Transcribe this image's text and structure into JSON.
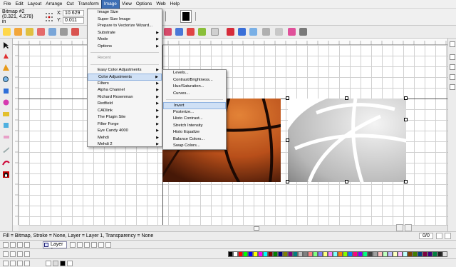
{
  "menubar": [
    "File",
    "Edit",
    "Layout",
    "Arrange",
    "Cut",
    "Transform",
    "Image",
    "View",
    "Options",
    "Web",
    "Help"
  ],
  "active_menu": "Image",
  "props": {
    "object_name": "Bitmap #2",
    "coords": "(0.321, 4.278)",
    "unit": "in",
    "x_label": "X:",
    "x_value": "10.629",
    "y_label": "Y:",
    "y_value": "0.011"
  },
  "image_menu": [
    {
      "label": "Image Size"
    },
    {
      "label": "Super Size Image"
    },
    {
      "label": "Prepare to Vectorize Wizard..."
    },
    {
      "label": "Substrate",
      "submenu": true
    },
    {
      "label": "Mode",
      "submenu": true
    },
    {
      "label": "Options",
      "submenu": true
    },
    {
      "sep": true
    },
    {
      "label": "Recent",
      "disabled": true
    },
    {
      "sep": true
    },
    {
      "label": "Easy Color Adjustments",
      "submenu": true
    },
    {
      "label": "Color Adjustments",
      "submenu": true,
      "highlighted": true
    },
    {
      "label": "Filters",
      "submenu": true
    },
    {
      "label": "Alpha Channel",
      "submenu": true
    },
    {
      "label": "Richard Rosenman",
      "submenu": true
    },
    {
      "label": "Redfield",
      "submenu": true
    },
    {
      "label": "CADlink",
      "submenu": true
    },
    {
      "label": "The Plugin Site",
      "submenu": true
    },
    {
      "label": "Filter Forge",
      "submenu": true
    },
    {
      "label": "Eye Candy 4000",
      "submenu": true
    },
    {
      "label": "Mehdi",
      "submenu": true
    },
    {
      "label": "Mehdi 2",
      "submenu": true
    }
  ],
  "color_submenu": [
    {
      "label": "Levels..."
    },
    {
      "label": "Contrast/Brightness..."
    },
    {
      "label": "Hue/Saturation..."
    },
    {
      "label": "Curves..."
    },
    {
      "sep": true
    },
    {
      "label": "Invert",
      "highlighted": true
    },
    {
      "label": "Posterize..."
    },
    {
      "label": "Histo Contrast..."
    },
    {
      "label": "Stretch Intensity"
    },
    {
      "label": "Histo Equalize"
    },
    {
      "label": "Balance Colors..."
    },
    {
      "label": "Swap Colors..."
    }
  ],
  "status_text": "Fill = Bitmap, Stroke = None, Layer = Layer 1, Transparency = None",
  "page_indicator": "0/0",
  "layer_name": "Layer 1",
  "colors": {
    "menu_highlight": "#3d6fb5",
    "submenu_highlight": "#cfe0f5",
    "basketball_orange": "#c35a1e",
    "grid": "#d0d0d0"
  },
  "palette": [
    "#000000",
    "#ffffff",
    "#ff0000",
    "#00ff00",
    "#0000ff",
    "#ffff00",
    "#ff00ff",
    "#00ffff",
    "#800000",
    "#008000",
    "#000080",
    "#808000",
    "#800080",
    "#008080",
    "#c0c0c0",
    "#808080",
    "#ff8080",
    "#80ff80",
    "#8080ff",
    "#ffff80",
    "#ff80ff",
    "#80ffff",
    "#ff8000",
    "#80ff00",
    "#0080ff",
    "#ff0080",
    "#8000ff",
    "#00ff80",
    "#404040",
    "#a0a0a0",
    "#ffc0c0",
    "#c0ffc0",
    "#c0c0ff",
    "#ffffc0",
    "#ffc0ff",
    "#c0ffff",
    "#804000",
    "#408000",
    "#004080",
    "#800040",
    "#400080",
    "#008040",
    "#202020",
    "#e0e0e0"
  ]
}
